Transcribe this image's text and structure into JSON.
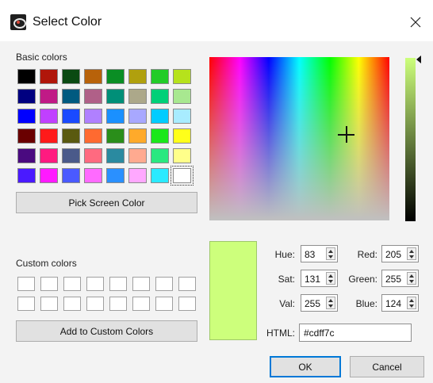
{
  "window": {
    "title": "Select Color",
    "icon": "app-icon",
    "close_icon": "close-icon"
  },
  "basic_colors": {
    "label": "Basic colors",
    "swatches": [
      "#000000",
      "#b0160a",
      "#0a4a12",
      "#b8620a",
      "#0a8e24",
      "#b0a00e",
      "#22cc28",
      "#b6e21c",
      "#000080",
      "#c01a86",
      "#005a80",
      "#b06088",
      "#008f78",
      "#aca88a",
      "#00d078",
      "#a8e890",
      "#0000ff",
      "#c040ff",
      "#1a4aff",
      "#b080ff",
      "#1a90ff",
      "#a8a8ff",
      "#00ccff",
      "#a8ecff",
      "#6a0000",
      "#ff1a1a",
      "#5a5a10",
      "#ff6a30",
      "#2a8e1a",
      "#ffaa2a",
      "#1ae81a",
      "#ffff1a",
      "#4a0a80",
      "#ff1a80",
      "#4a5a8a",
      "#ff6a80",
      "#2a8aa0",
      "#ffaa90",
      "#2ae880",
      "#ffff8a",
      "#4a1aff",
      "#ff1aff",
      "#4a5aff",
      "#ff6aff",
      "#2a90ff",
      "#ffa8ff",
      "#2aeaff",
      "#ffffff"
    ],
    "selected_index": 47
  },
  "pick_screen_color_label": "Pick Screen Color",
  "custom_colors": {
    "label": "Custom colors",
    "count": 16
  },
  "add_custom_label": "Add to Custom Colors",
  "current_color": "#cdff7c",
  "fields": {
    "hue": {
      "label": "Hue:",
      "value": "83"
    },
    "sat": {
      "label": "Sat:",
      "value": "131"
    },
    "val": {
      "label": "Val:",
      "value": "255"
    },
    "red": {
      "label": "Red:",
      "value": "205"
    },
    "green": {
      "label": "Green:",
      "value": "255"
    },
    "blue": {
      "label": "Blue:",
      "value": "124"
    },
    "html": {
      "label": "HTML:",
      "value": "#cdff7c"
    }
  },
  "buttons": {
    "ok": "OK",
    "cancel": "Cancel"
  },
  "icons": {
    "spin_up": "chevron-up-icon",
    "spin_down": "chevron-down-icon",
    "crosshair": "crosshair-icon",
    "value_indicator": "triangle-left-icon"
  }
}
